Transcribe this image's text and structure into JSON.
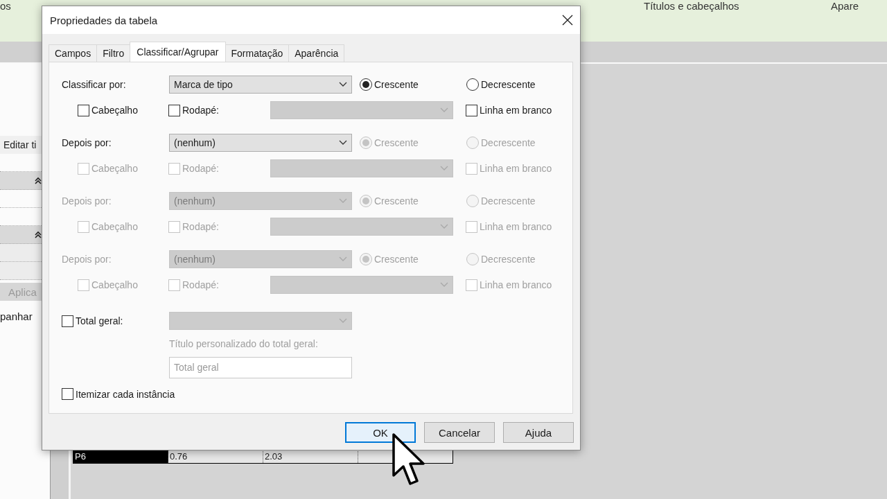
{
  "ribbon": {
    "panel_titles": [
      "os",
      "Títulos e cabeçalhos",
      "Apare"
    ]
  },
  "properties_panel": {
    "edit_button": "Editar ti",
    "apply_button": "Aplica",
    "bottom_text": "panhar"
  },
  "schedule": {
    "rows": [
      {
        "cells": [
          {
            "text": "P6",
            "selected": true
          },
          {
            "text": "0.76",
            "selected": false
          },
          {
            "text": "2.03",
            "selected": false
          }
        ]
      }
    ]
  },
  "dialog": {
    "title": "Propriedades da tabela",
    "tabs": [
      {
        "label": "Campos",
        "selected": false
      },
      {
        "label": "Filtro",
        "selected": false
      },
      {
        "label": "Classificar/Agrupar",
        "selected": true
      },
      {
        "label": "Formatação",
        "selected": false
      },
      {
        "label": "Aparência",
        "selected": false
      }
    ],
    "sort_levels": [
      {
        "label": "Classificar por:",
        "disabled": false,
        "field": "Marca de tipo",
        "orders": [
          {
            "label": "Crescente",
            "selected": true,
            "disabled": false
          },
          {
            "label": "Decrescente",
            "selected": false,
            "disabled": false
          }
        ],
        "header": {
          "label": "Cabeçalho",
          "checked": false,
          "disabled": false
        },
        "footer": {
          "label": "Rodapé:",
          "checked": false,
          "disabled": false
        },
        "blank_line": {
          "label": "Linha em branco",
          "checked": false,
          "disabled": false
        }
      },
      {
        "label": "Depois por:",
        "disabled": false,
        "field": "(nenhum)",
        "orders": [
          {
            "label": "Crescente",
            "selected": true,
            "disabled": true
          },
          {
            "label": "Decrescente",
            "selected": false,
            "disabled": true
          }
        ],
        "header": {
          "label": "Cabeçalho",
          "checked": false,
          "disabled": true
        },
        "footer": {
          "label": "Rodapé:",
          "checked": false,
          "disabled": true
        },
        "blank_line": {
          "label": "Linha em branco",
          "checked": false,
          "disabled": true
        }
      },
      {
        "label": "Depois por:",
        "disabled": true,
        "field": "(nenhum)",
        "orders": [
          {
            "label": "Crescente",
            "selected": true,
            "disabled": true
          },
          {
            "label": "Decrescente",
            "selected": false,
            "disabled": true
          }
        ],
        "header": {
          "label": "Cabeçalho",
          "checked": false,
          "disabled": true
        },
        "footer": {
          "label": "Rodapé:",
          "checked": false,
          "disabled": true
        },
        "blank_line": {
          "label": "Linha em branco",
          "checked": false,
          "disabled": true
        }
      },
      {
        "label": "Depois por:",
        "disabled": true,
        "field": "(nenhum)",
        "orders": [
          {
            "label": "Crescente",
            "selected": true,
            "disabled": true
          },
          {
            "label": "Decrescente",
            "selected": false,
            "disabled": true
          }
        ],
        "header": {
          "label": "Cabeçalho",
          "checked": false,
          "disabled": true
        },
        "footer": {
          "label": "Rodapé:",
          "checked": false,
          "disabled": true
        },
        "blank_line": {
          "label": "Linha em branco",
          "checked": false,
          "disabled": true
        }
      }
    ],
    "grand_total": {
      "label": "Total geral:",
      "checked": false,
      "caption": "Título personalizado do total geral:",
      "value": "Total geral"
    },
    "itemize": {
      "label": "Itemizar cada instância",
      "checked": false
    },
    "buttons": [
      {
        "label": "OK",
        "default": true
      },
      {
        "label": "Cancelar",
        "default": false
      },
      {
        "label": "Ajuda",
        "default": false
      }
    ]
  }
}
